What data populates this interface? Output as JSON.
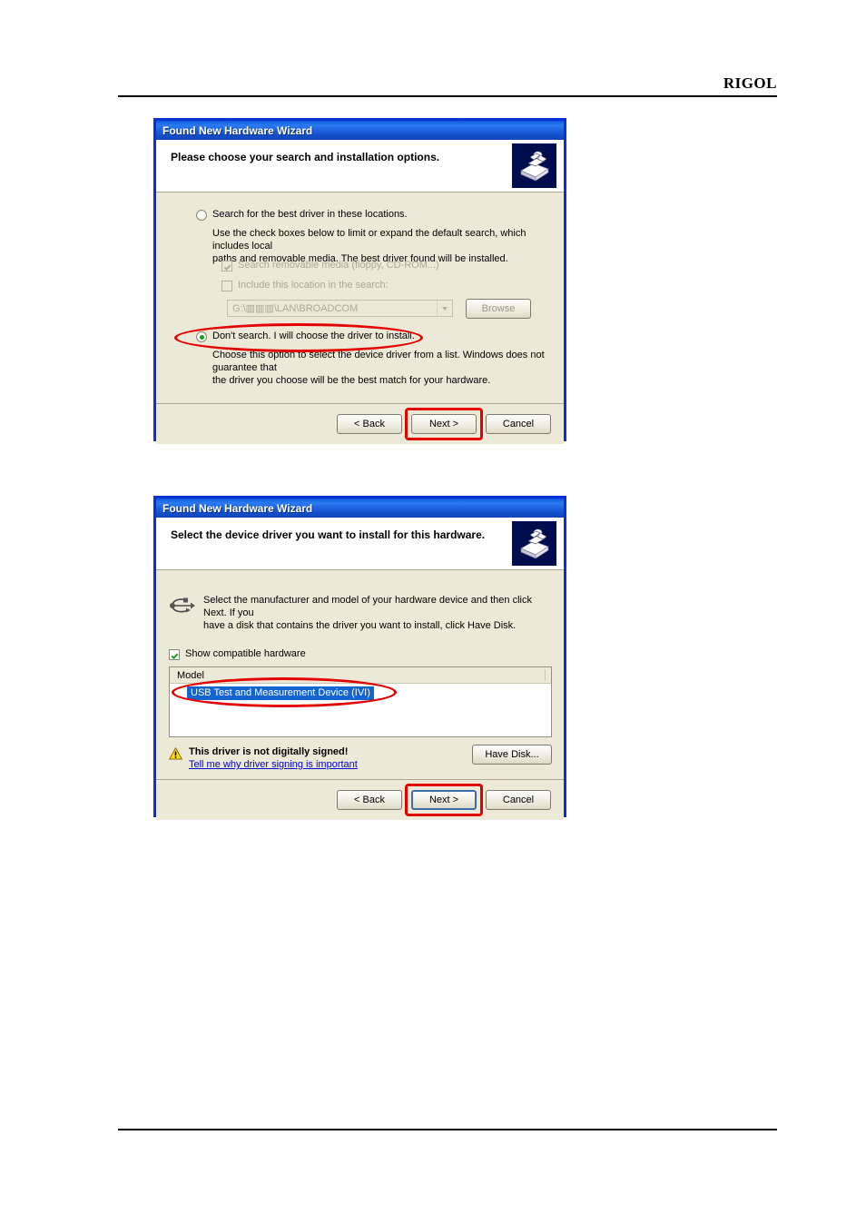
{
  "page": {
    "brand": "RIGOL"
  },
  "dialog1": {
    "window_title": "Found New Hardware Wizard",
    "heading": "Please choose your search and installation options.",
    "wizard_icon": "hardware-wizard-icon",
    "option_search": {
      "label": "Search for the best driver in these locations.",
      "selected": false,
      "description_line1": "Use the check boxes below to limit or expand the default search, which includes local",
      "description_line2": "paths and removable media. The best driver found will be installed.",
      "checkbox_removable": {
        "label": "Search removable media (floppy, CD-ROM...)",
        "checked": true,
        "enabled": false
      },
      "checkbox_include_location": {
        "label": "Include this location in the search:",
        "checked": false,
        "enabled": false
      },
      "location_combo": {
        "value": "G:\\▥▥▥\\LAN\\BROADCOM",
        "enabled": false
      },
      "browse_button": "Browse"
    },
    "option_dont_search": {
      "label": "Don't search. I will choose the driver to install.",
      "selected": true,
      "highlighted": true,
      "description_line1": "Choose this option to select the device driver from a list. Windows does not guarantee that",
      "description_line2": "the driver you choose will be the best match for your hardware."
    },
    "buttons": {
      "back": "< Back",
      "next": "Next >",
      "cancel": "Cancel",
      "next_highlighted": true
    }
  },
  "dialog2": {
    "window_title": "Found New Hardware Wizard",
    "heading": "Select the device driver you want to install for this hardware.",
    "wizard_icon": "hardware-wizard-icon",
    "device_icon": "usb-icon",
    "instruction_line1": "Select the manufacturer and model of your hardware device and then click Next. If you",
    "instruction_line2": "have a disk that contains the driver you want to install, click Have Disk.",
    "show_compatible": {
      "label": "Show compatible hardware",
      "checked": true
    },
    "model_list": {
      "column_header": "Model",
      "items": [
        "USB Test and Measurement Device (IVI)"
      ],
      "selected_index": 0,
      "highlighted": true
    },
    "warning": {
      "icon": "warning-triangle-icon",
      "title": "This driver is not digitally signed!",
      "link": "Tell me why driver signing is important"
    },
    "have_disk_button": "Have Disk...",
    "buttons": {
      "back": "< Back",
      "next": "Next >",
      "cancel": "Cancel",
      "next_focused": true,
      "next_highlighted": true
    }
  },
  "colors": {
    "dialog_face": "#ece9d8",
    "title_blue": "#0a53d6",
    "highlight_red": "#e50000",
    "selection_blue": "#1364d0",
    "link_blue": "#0000cc"
  }
}
